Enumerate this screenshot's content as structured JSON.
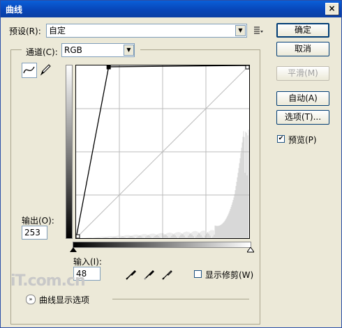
{
  "window": {
    "title": "曲线",
    "close_label": "×"
  },
  "preset": {
    "label": "预设(R):",
    "value": "自定",
    "menu_icon": "list-icon"
  },
  "channel": {
    "label": "通道(C):",
    "value": "RGB"
  },
  "buttons": {
    "ok": "确定",
    "cancel": "取消",
    "smooth": "平滑(M)",
    "auto": "自动(A)",
    "options": "选项(T)..."
  },
  "preview": {
    "label": "预览(P)",
    "checked": true,
    "check_mark": "✔"
  },
  "output": {
    "label": "输出(O):",
    "value": "253"
  },
  "input": {
    "label": "输入(I):",
    "value": "48"
  },
  "clipping": {
    "label": "显示修剪(W)",
    "checked": false
  },
  "curve_options": {
    "label": "曲线显示选项",
    "toggle_icon": "double-chevron-down-icon"
  },
  "watermark": "iT.com.cn",
  "curve_points": [
    [
      0,
      0
    ],
    [
      48,
      253
    ],
    [
      255,
      255
    ]
  ],
  "colors": {
    "title_bar": "#0846b8",
    "window_bg": "#ece9d8",
    "histogram": "#d8d8d8"
  }
}
